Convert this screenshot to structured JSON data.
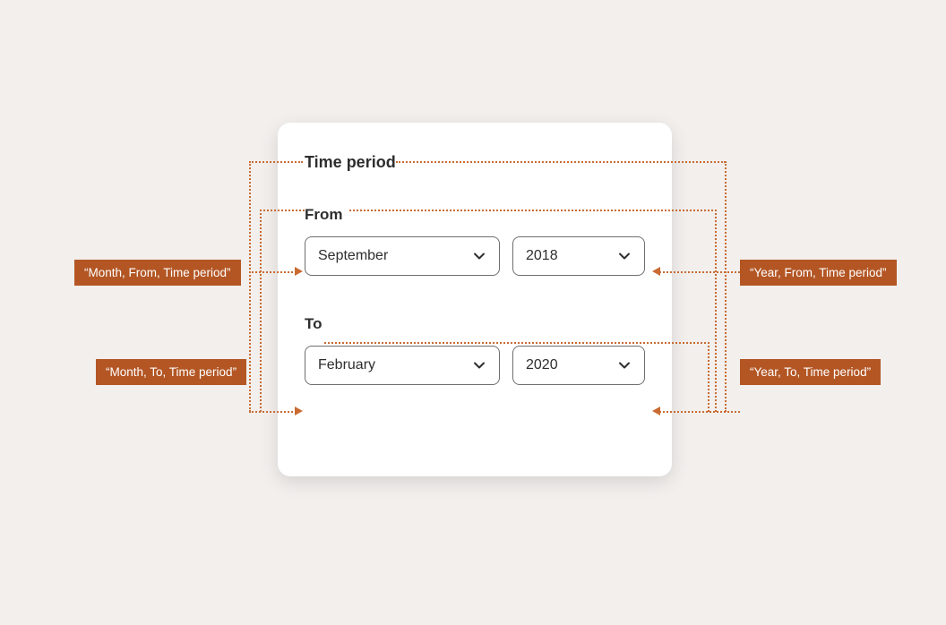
{
  "card": {
    "title": "Time period",
    "from": {
      "label": "From",
      "month": "September",
      "year": "2018"
    },
    "to": {
      "label": "To",
      "month": "February",
      "year": "2020"
    }
  },
  "annotations": {
    "month_from": "“Month, From, Time period”",
    "month_to": "“Month, To, Time period”",
    "year_from": "“Year, From, Time period”",
    "year_to": "“Year, To, Time period”"
  }
}
